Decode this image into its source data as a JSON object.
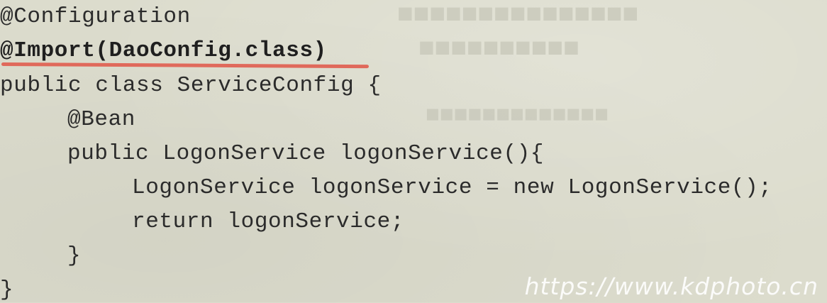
{
  "code": {
    "lines": [
      "@Configuration",
      "@Import(DaoConfig.class)",
      "public class ServiceConfig {",
      "@Bean",
      "public LogonService logonService(){",
      "LogonService logonService = new LogonService();",
      "return logonService;",
      "}",
      "}"
    ]
  },
  "annotation": {
    "underline_color": "#e0695b"
  },
  "background_color": "#dcdccd",
  "watermark": "https://www.kdphoto.cn"
}
